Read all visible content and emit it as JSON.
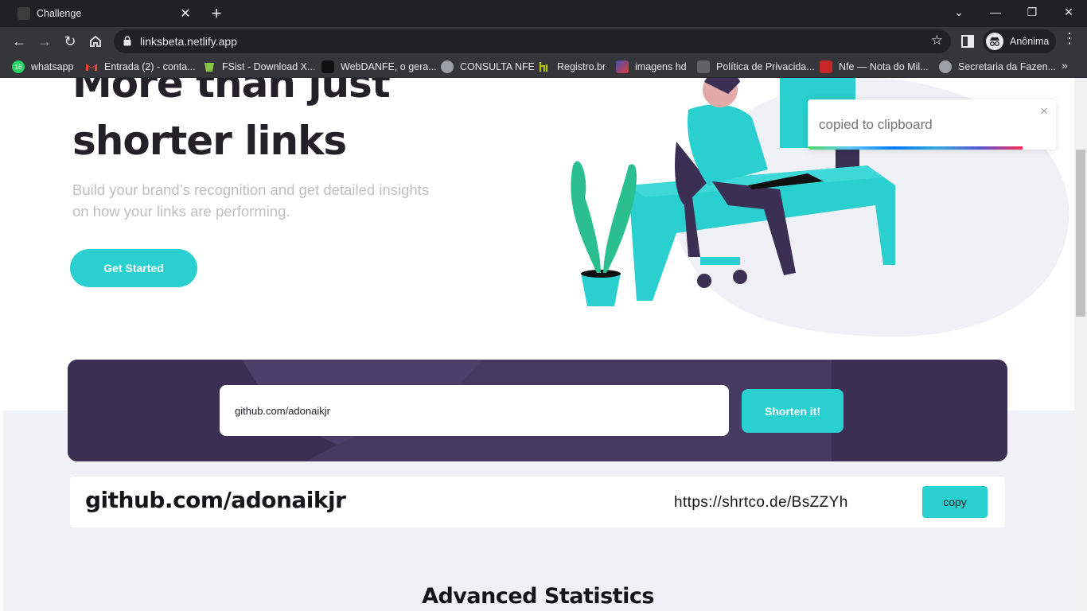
{
  "browser": {
    "tab_title": "Challenge",
    "url": "linksbeta.netlify.app",
    "profile_label": "Anônima",
    "bookmarks": [
      {
        "label": "whatsapp",
        "color": "#25d366"
      },
      {
        "label": "Entrada (2) - conta...",
        "color": "#ea4335"
      },
      {
        "label": "FSist - Download X...",
        "color": "#8bc34a"
      },
      {
        "label": "WebDANFE, o gera...",
        "color": "#111111"
      },
      {
        "label": "CONSULTA NFE",
        "color": "#9aa0a6"
      },
      {
        "label": "Registro.br",
        "color": "#b5c200"
      },
      {
        "label": "imagens hd",
        "color": "#3f51b5"
      },
      {
        "label": "Política de Privacida...",
        "color": "#5f6368"
      },
      {
        "label": "Nfe — Nota do Mil...",
        "color": "#c62828"
      },
      {
        "label": "Secretaria da Fazen...",
        "color": "#9aa0a6"
      }
    ],
    "whatsapp_badge": "16"
  },
  "hero": {
    "title_line1": "More than just",
    "title_line2": "shorter links",
    "subtitle": "Build your brand’s recognition and get detailed insights on how your links are performing.",
    "cta_label": "Get Started"
  },
  "toast": {
    "message": "copied to clipboard",
    "close_glyph": "×"
  },
  "shortener": {
    "input_value": "github.com/adonaikjr",
    "button_label": "Shorten it!"
  },
  "result": {
    "original": "github.com/adonaikjr",
    "short": "https://shrtco.de/BsZZYh",
    "copy_label": "copy"
  },
  "stats": {
    "title": "Advanced Statistics"
  },
  "colors": {
    "cyan": "#2acfcf",
    "dark_violet": "#3b3054",
    "gray_bg": "#f0f1f6",
    "very_dark": "#232127"
  }
}
